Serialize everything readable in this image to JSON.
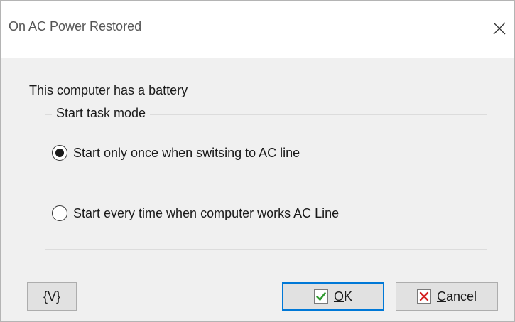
{
  "window": {
    "title": "On AC Power Restored",
    "close_icon": "close-icon"
  },
  "content": {
    "info_text": "This computer has a battery",
    "group": {
      "title": "Start task mode",
      "options": [
        {
          "label": "Start only once when switsing to AC line",
          "selected": true
        },
        {
          "label": "Start every time when computer works AC Line",
          "selected": false
        }
      ]
    }
  },
  "buttons": {
    "variables": "{V}",
    "ok": {
      "mnemonic": "O",
      "rest": "K",
      "icon": "check-icon",
      "icon_color": "#2e9a2e"
    },
    "cancel": {
      "mnemonic": "C",
      "rest": "ancel",
      "icon": "x-icon",
      "icon_color": "#d42020"
    }
  }
}
